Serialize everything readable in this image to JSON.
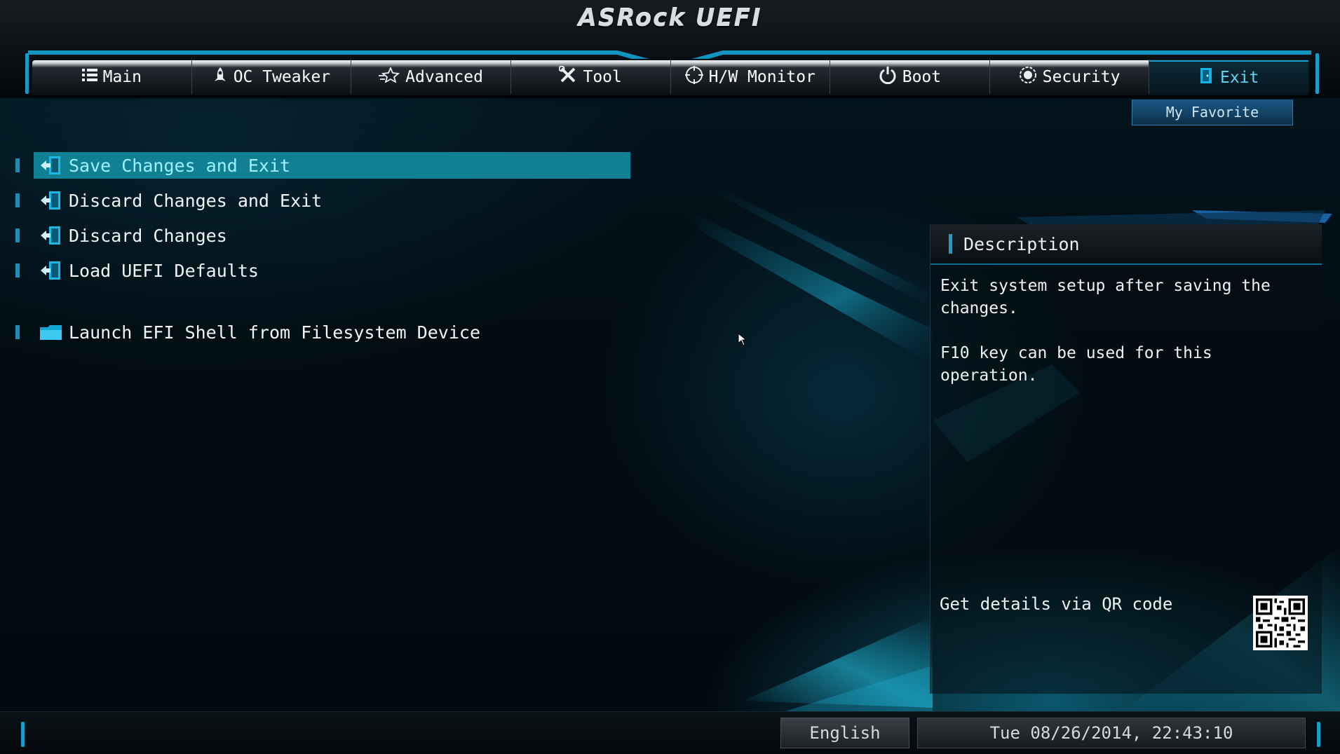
{
  "header": {
    "title": "ASRock UEFI"
  },
  "tabs": [
    {
      "label": "Main",
      "icon": "list-icon"
    },
    {
      "label": "OC Tweaker",
      "icon": "rocket-icon"
    },
    {
      "label": "Advanced",
      "icon": "star-icon"
    },
    {
      "label": "Tool",
      "icon": "tools-icon"
    },
    {
      "label": "H/W Monitor",
      "icon": "crosshair-icon"
    },
    {
      "label": "Boot",
      "icon": "power-icon"
    },
    {
      "label": "Security",
      "icon": "shield-icon"
    },
    {
      "label": "Exit",
      "icon": "door-icon",
      "active": true
    }
  ],
  "favorite": {
    "label": "My Favorite"
  },
  "menu": {
    "items": [
      {
        "label": "Save Changes and Exit",
        "icon": "exit-icon",
        "selected": true
      },
      {
        "label": "Discard Changes and Exit",
        "icon": "exit-icon"
      },
      {
        "label": "Discard Changes",
        "icon": "exit-icon"
      },
      {
        "label": "Load UEFI Defaults",
        "icon": "exit-icon"
      },
      {
        "label": "Launch EFI Shell from Filesystem Device",
        "icon": "folder-icon"
      }
    ]
  },
  "description": {
    "title": "Description",
    "text": "Exit system setup after saving the\nchanges.\n\nF10 key can be used for this operation.",
    "qr_label": "Get details via QR code"
  },
  "footer": {
    "language": "English",
    "datetime": "Tue 08/26/2014, 22:43:10"
  },
  "colors": {
    "accent": "#15a3cf",
    "selected_row": "#117f94",
    "active_tab_text": "#5fd6f5"
  }
}
